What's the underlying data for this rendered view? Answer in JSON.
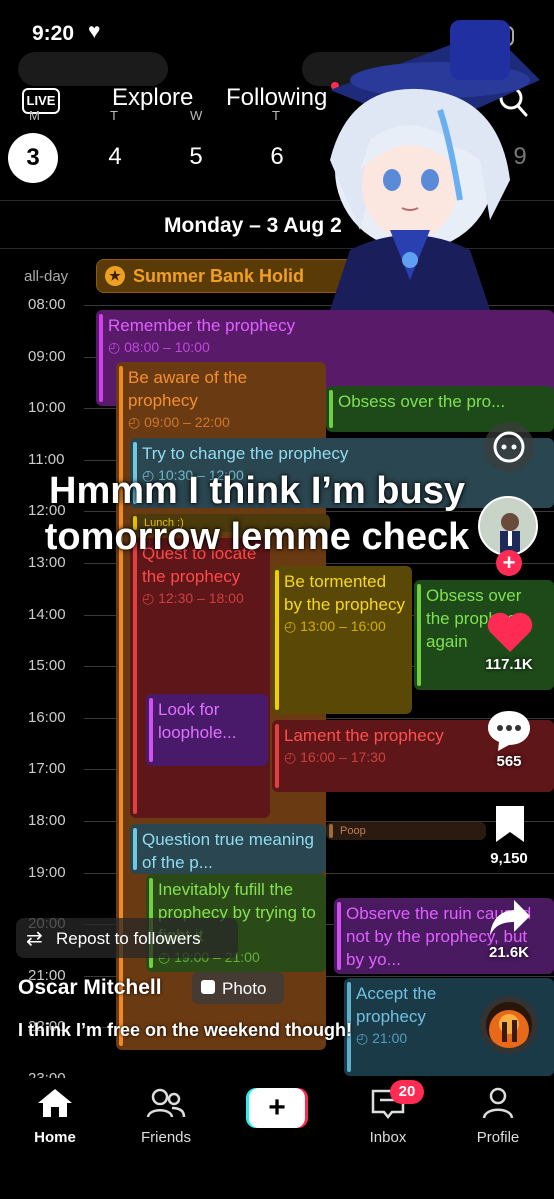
{
  "status": {
    "time": "9:20",
    "heart": "♥"
  },
  "top_nav": {
    "live": "LIVE",
    "explore": "Explore",
    "following": "Following"
  },
  "week": {
    "day_letters": [
      "M",
      "T",
      "W",
      "T"
    ],
    "dates": [
      "3",
      "4",
      "5",
      "6",
      "9"
    ]
  },
  "day_title": "Monday – 3 Aug 2",
  "allday": {
    "label": "all-day",
    "event": "Summer Bank Holid"
  },
  "hours": [
    "08:00",
    "09:00",
    "10:00",
    "11:00",
    "12:00",
    "13:00",
    "14:00",
    "15:00",
    "16:00",
    "17:00",
    "18:00",
    "19:00",
    "20:00",
    "21:00",
    "22:00",
    "23:00"
  ],
  "events": [
    {
      "id": "remember",
      "title": "Remember the prophecy",
      "time": "08:00 – 10:00"
    },
    {
      "id": "aware",
      "title": "Be aware of the prophecy",
      "time": "09:00 – 22:00"
    },
    {
      "id": "obsess1",
      "title": "Obsess over the pro..."
    },
    {
      "id": "try",
      "title": "Try to change the prophecy",
      "time": "10:30 – 12:00"
    },
    {
      "id": "lunch",
      "title": "Lunch :)"
    },
    {
      "id": "quest",
      "title": "Quest to locate the prophecy",
      "time": "12:30 – 18:00"
    },
    {
      "id": "tormented",
      "title": "Be tormented by the prophecy",
      "time": "13:00 – 16:00"
    },
    {
      "id": "obsess2",
      "title": "Obsess over the prophecy again"
    },
    {
      "id": "loophole",
      "title": "Look for loophole..."
    },
    {
      "id": "lament",
      "title": "Lament the prophecy",
      "time": "16:00 – 17:30"
    },
    {
      "id": "poop",
      "title": "Poop"
    },
    {
      "id": "question",
      "title": "Question true meaning of the p..."
    },
    {
      "id": "fufill",
      "title": "Inevitably fufill the prophecy by trying to fight it",
      "time": "19:00 – 21:00"
    },
    {
      "id": "ruin",
      "title": "Observe the ruin caused not by the prophecy, but by yo..."
    },
    {
      "id": "accept",
      "title": "Accept the prophecy",
      "time": "21:00"
    }
  ],
  "overlay": {
    "caption_line1": "Hmmm I think I’m busy",
    "caption_line2": "tomorrow lemme check",
    "repost": "Repost to followers",
    "author": "Oscar Mitchell",
    "photo_badge": "Photo",
    "description": "I think I’m free on the weekend though!",
    "likes": "117.1K",
    "comments": "565",
    "saves": "9,150",
    "shares": "21.6K"
  },
  "bottom_nav": {
    "home": "Home",
    "friends": "Friends",
    "inbox": "Inbox",
    "inbox_badge": "20",
    "profile": "Profile"
  },
  "colors": {
    "purple": "#b030d0",
    "orange": "#e07a20",
    "green": "#70c040",
    "teal": "#60b0c8",
    "red": "#d03a3a",
    "yellow": "#e6c000",
    "heart": "#fe2c55"
  }
}
